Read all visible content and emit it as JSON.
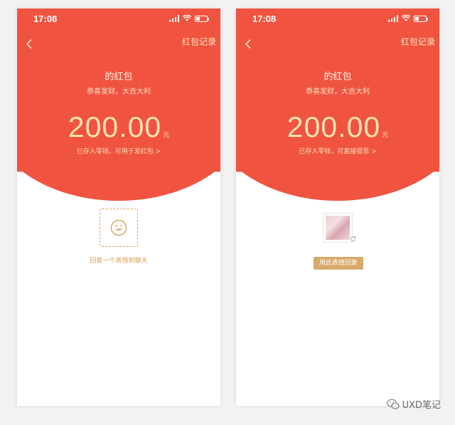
{
  "screens": [
    {
      "status_time": "17:08",
      "nav_record": "红包记录",
      "sender": "的红包",
      "wish": "恭喜发财，大吉大利",
      "amount": "200.00",
      "unit": "元",
      "saved_note": "已存入零钱，可用于发红包 >",
      "reply_hint": "回复一个表情到聊天"
    },
    {
      "status_time": "17:08",
      "nav_record": "红包记录",
      "sender": "的红包",
      "wish": "恭喜发财，大吉大利",
      "amount": "200.00",
      "unit": "元",
      "saved_note": "已存入零钱，可直接提现 >",
      "use_sticker_button": "用此表情回复"
    }
  ],
  "watermark": "UXD笔记",
  "icons": [
    "signal-icon",
    "wifi-icon",
    "battery-icon",
    "back-chevron-icon",
    "smile-icon",
    "refresh-icon",
    "wechat-icon"
  ],
  "colors": {
    "header_red": "#f05441",
    "gold_text": "#fde3b0",
    "accent_gold": "#d7a96b",
    "background": "#f2f2f2"
  }
}
